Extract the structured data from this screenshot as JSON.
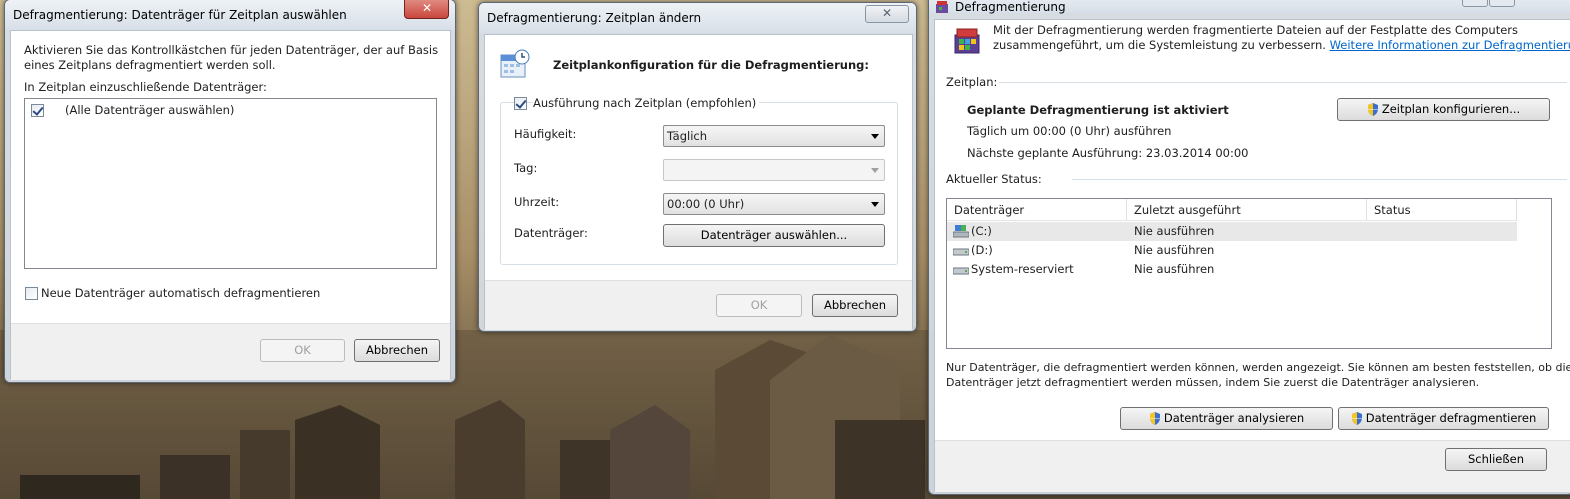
{
  "dialog_select": {
    "title": "Defragmentierung: Datenträger für Zeitplan auswählen",
    "instruction": "Aktivieren Sie das Kontrollkästchen für jeden Datenträger, der auf Basis eines Zeitplans defragmentiert werden soll.",
    "list_label": "In Zeitplan einzuschließende Datenträger:",
    "all_drives_label": "(Alle Datenträger auswählen)",
    "auto_new_label": "Neue Datenträger automatisch defragmentieren",
    "ok": "OK",
    "cancel": "Abbrechen"
  },
  "dialog_schedule": {
    "title": "Defragmentierung: Zeitplan ändern",
    "heading": "Zeitplankonfiguration für die Defragmentierung:",
    "run_on_schedule": "Ausführung nach Zeitplan (empfohlen)",
    "frequency_label": "Häufigkeit:",
    "frequency_value": "Täglich",
    "day_label": "Tag:",
    "day_value": "",
    "time_label": "Uhrzeit:",
    "time_value": "00:00 (0 Uhr)",
    "drives_label": "Datenträger:",
    "select_drives_btn": "Datenträger auswählen...",
    "ok": "OK",
    "cancel": "Abbrechen"
  },
  "main": {
    "title": "Defragmentierung",
    "intro": "Mit der Defragmentierung werden fragmentierte Dateien auf der Festplatte des Computers",
    "intro2": "zusammengeführt, um die Systemleistung zu verbessern.",
    "intro_link": "Weitere Informationen zur Defragmentierung",
    "schedule_group": "Zeitplan:",
    "schedule_status": "Geplante Defragmentierung ist aktiviert",
    "schedule_detail": "Täglich um 00:00 (0 Uhr) ausführen",
    "next_run": "Nächste geplante Ausführung: 23.03.2014 00:00",
    "configure_btn": "Zeitplan konfigurieren...",
    "status_group": "Aktueller Status:",
    "columns": [
      "Datenträger",
      "Zuletzt ausgeführt",
      "Status"
    ],
    "rows": [
      {
        "drive": "(C:)",
        "last": "Nie ausführen",
        "status": ""
      },
      {
        "drive": "(D:)",
        "last": "Nie ausführen",
        "status": ""
      },
      {
        "drive": "System-reserviert",
        "last": "Nie ausführen",
        "status": ""
      }
    ],
    "note1": "Nur Datenträger, die defragmentiert werden können, werden angezeigt. Sie können am besten feststellen, ob die",
    "note2": "Datenträger jetzt defragmentiert werden müssen, indem Sie zuerst die Datenträger analysieren.",
    "analyze_btn": "Datenträger analysieren",
    "defrag_btn": "Datenträger defragmentieren",
    "close_btn": "Schließen"
  },
  "colors": {
    "link": "#0066cc",
    "close_button": "#c9463d",
    "selected_row": "#e8e8e8"
  }
}
